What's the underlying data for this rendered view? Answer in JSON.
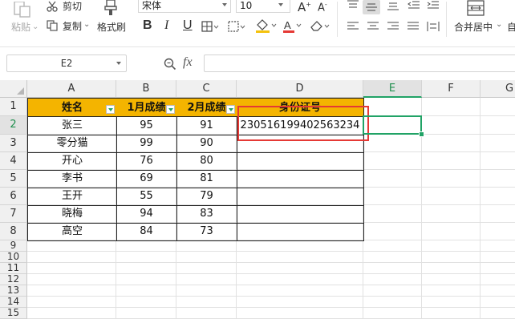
{
  "ribbon": {
    "cut_label": "剪切",
    "paste_label": "粘贴",
    "copy_label": "复制",
    "format_painter_label": "格式刷",
    "font_name": "宋体",
    "font_size": "10",
    "merge_center_label": "合并居中",
    "auto_label": "自"
  },
  "formula_bar": {
    "name_box": "E2",
    "fx_label": "fx",
    "formula_value": ""
  },
  "sheet": {
    "columns": [
      "A",
      "B",
      "C",
      "D",
      "E",
      "F",
      "G"
    ],
    "rows": [
      "1",
      "2",
      "3",
      "4",
      "5",
      "6",
      "7",
      "8",
      "9",
      "10",
      "11",
      "12",
      "13",
      "14",
      "15"
    ],
    "selected_column": "E",
    "selected_row": "2",
    "headers": [
      "姓名",
      "1月成绩",
      "2月成绩",
      "身份证号"
    ],
    "data": [
      [
        "张三",
        "95",
        "91",
        "230516199402563234"
      ],
      [
        "零分猫",
        "99",
        "90",
        ""
      ],
      [
        "开心",
        "76",
        "80",
        ""
      ],
      [
        "李书",
        "69",
        "81",
        ""
      ],
      [
        "王开",
        "55",
        "79",
        ""
      ],
      [
        "晓梅",
        "94",
        "83",
        ""
      ],
      [
        "高空",
        "84",
        "73",
        ""
      ]
    ]
  },
  "colors": {
    "header_fill": "#f4b400",
    "selection": "#21a366",
    "highlight_box": "#e53935"
  }
}
